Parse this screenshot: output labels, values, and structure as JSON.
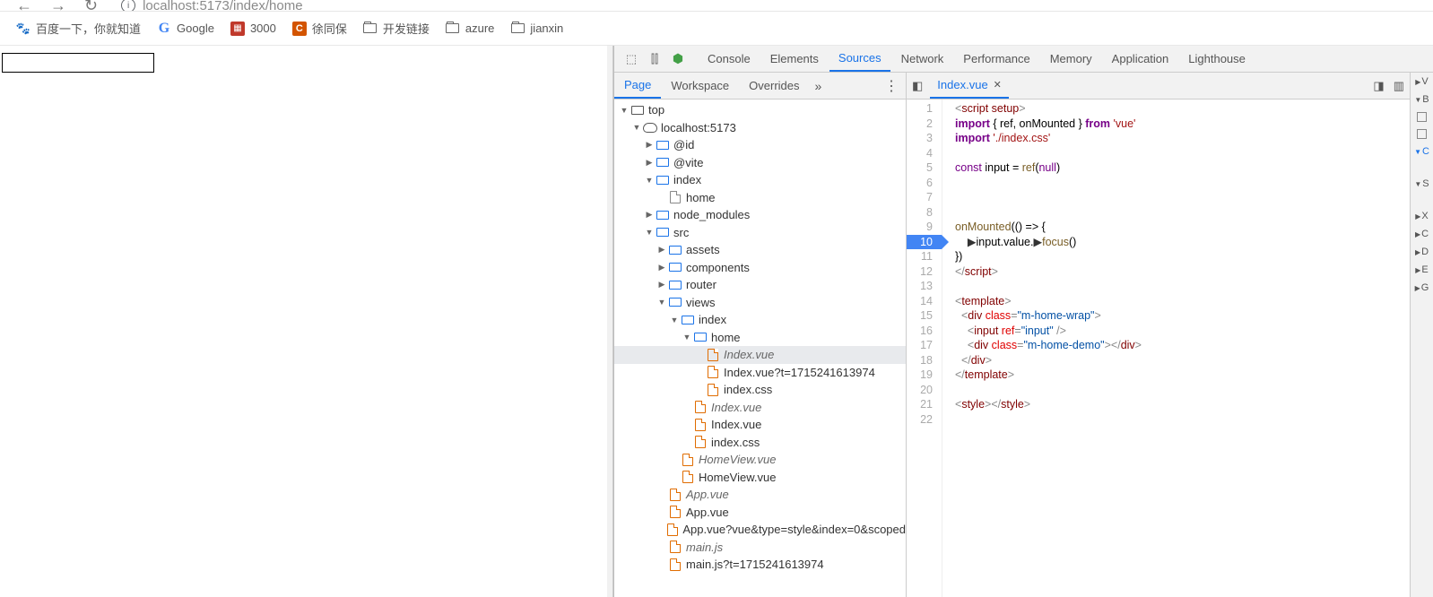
{
  "url": "localhost:5173/index/home",
  "bookmarks": [
    {
      "icon": "paw",
      "label": "百度一下，你就知道"
    },
    {
      "icon": "g",
      "label": "Google"
    },
    {
      "icon": "3000",
      "label": "3000"
    },
    {
      "icon": "c",
      "label": "徐同保"
    },
    {
      "icon": "folder",
      "label": "开发链接"
    },
    {
      "icon": "folder",
      "label": "azure"
    },
    {
      "icon": "folder",
      "label": "jianxin"
    }
  ],
  "devtoolsTabs": [
    "Console",
    "Elements",
    "Sources",
    "Network",
    "Performance",
    "Memory",
    "Application",
    "Lighthouse"
  ],
  "activeDevtoolsTab": "Sources",
  "sourcesTabs": [
    "Page",
    "Workspace",
    "Overrides"
  ],
  "activeSourcesTab": "Page",
  "tree": [
    {
      "d": 0,
      "tw": "▼",
      "ico": "fold",
      "label": "top"
    },
    {
      "d": 1,
      "tw": "▼",
      "ico": "cloud",
      "label": "localhost:5173"
    },
    {
      "d": 2,
      "tw": "▶",
      "ico": "foldb",
      "label": "@id"
    },
    {
      "d": 2,
      "tw": "▶",
      "ico": "foldb",
      "label": "@vite"
    },
    {
      "d": 2,
      "tw": "▼",
      "ico": "foldb",
      "label": "index"
    },
    {
      "d": 3,
      "tw": "",
      "ico": "file",
      "label": "home"
    },
    {
      "d": 2,
      "tw": "▶",
      "ico": "foldb",
      "label": "node_modules"
    },
    {
      "d": 2,
      "tw": "▼",
      "ico": "foldb",
      "label": "src"
    },
    {
      "d": 3,
      "tw": "▶",
      "ico": "foldb",
      "label": "assets"
    },
    {
      "d": 3,
      "tw": "▶",
      "ico": "foldb",
      "label": "components"
    },
    {
      "d": 3,
      "tw": "▶",
      "ico": "foldb",
      "label": "router"
    },
    {
      "d": 3,
      "tw": "▼",
      "ico": "foldb",
      "label": "views"
    },
    {
      "d": 4,
      "tw": "▼",
      "ico": "foldb",
      "label": "index"
    },
    {
      "d": 5,
      "tw": "▼",
      "ico": "foldb",
      "label": "home"
    },
    {
      "d": 6,
      "tw": "",
      "ico": "fileo",
      "label": "Index.vue",
      "italic": true,
      "sel": true
    },
    {
      "d": 6,
      "tw": "",
      "ico": "fileo",
      "label": "Index.vue?t=1715241613974"
    },
    {
      "d": 6,
      "tw": "",
      "ico": "fileo",
      "label": "index.css"
    },
    {
      "d": 5,
      "tw": "",
      "ico": "fileo",
      "label": "Index.vue",
      "italic": true
    },
    {
      "d": 5,
      "tw": "",
      "ico": "fileo",
      "label": "Index.vue"
    },
    {
      "d": 5,
      "tw": "",
      "ico": "fileo",
      "label": "index.css"
    },
    {
      "d": 4,
      "tw": "",
      "ico": "fileo",
      "label": "HomeView.vue",
      "italic": true
    },
    {
      "d": 4,
      "tw": "",
      "ico": "fileo",
      "label": "HomeView.vue"
    },
    {
      "d": 3,
      "tw": "",
      "ico": "fileo",
      "label": "App.vue",
      "italic": true
    },
    {
      "d": 3,
      "tw": "",
      "ico": "fileo",
      "label": "App.vue"
    },
    {
      "d": 3,
      "tw": "",
      "ico": "fileo",
      "label": "App.vue?vue&type=style&index=0&scoped"
    },
    {
      "d": 3,
      "tw": "",
      "ico": "fileo",
      "label": "main.js",
      "italic": true
    },
    {
      "d": 3,
      "tw": "",
      "ico": "fileo",
      "label": "main.js?t=1715241613974"
    }
  ],
  "openFile": "Index.vue",
  "highlightLine": 10,
  "code": [
    {
      "n": 1,
      "spans": [
        [
          "<",
          "gr"
        ],
        [
          "script setup",
          "tag"
        ],
        [
          ">",
          "gr"
        ]
      ]
    },
    {
      "n": 2,
      "spans": [
        [
          "import",
          "imp"
        ],
        [
          " { ref, onMounted } ",
          "id"
        ],
        [
          "from",
          "imp"
        ],
        [
          " ",
          "id"
        ],
        [
          "'vue'",
          "br"
        ]
      ]
    },
    {
      "n": 3,
      "spans": [
        [
          "import",
          "imp"
        ],
        [
          " ",
          "id"
        ],
        [
          "'./index.css'",
          "br"
        ]
      ]
    },
    {
      "n": 4,
      "spans": []
    },
    {
      "n": 5,
      "spans": [
        [
          "const",
          "kw"
        ],
        [
          " input = ",
          "id"
        ],
        [
          "ref",
          "fn"
        ],
        [
          "(",
          "id"
        ],
        [
          "null",
          "kw"
        ],
        [
          ")",
          "id"
        ]
      ]
    },
    {
      "n": 6,
      "spans": []
    },
    {
      "n": 7,
      "spans": []
    },
    {
      "n": 8,
      "spans": []
    },
    {
      "n": 9,
      "spans": [
        [
          "onMounted",
          "fn"
        ],
        [
          "(() => {",
          "id"
        ]
      ]
    },
    {
      "n": 10,
      "spans": [
        [
          "    ",
          "id"
        ],
        [
          "▶",
          "bp"
        ],
        [
          "input",
          "id"
        ],
        [
          ".value.",
          "id"
        ],
        [
          "▶",
          "bp"
        ],
        [
          "focus",
          "fn"
        ],
        [
          "()",
          "id"
        ]
      ]
    },
    {
      "n": 11,
      "spans": [
        [
          "})",
          "id"
        ]
      ]
    },
    {
      "n": 12,
      "spans": [
        [
          "</",
          "gr"
        ],
        [
          "script",
          "tag"
        ],
        [
          ">",
          "gr"
        ]
      ]
    },
    {
      "n": 13,
      "spans": []
    },
    {
      "n": 14,
      "spans": [
        [
          "<",
          "gr"
        ],
        [
          "template",
          "tag"
        ],
        [
          ">",
          "gr"
        ]
      ]
    },
    {
      "n": 15,
      "spans": [
        [
          "  <",
          "gr"
        ],
        [
          "div",
          "tag"
        ],
        [
          " class",
          "attr"
        ],
        [
          "=",
          "gr"
        ],
        [
          "\"m-home-wrap\"",
          "val"
        ],
        [
          ">",
          "gr"
        ]
      ]
    },
    {
      "n": 16,
      "spans": [
        [
          "    <",
          "gr"
        ],
        [
          "input",
          "tag"
        ],
        [
          " ref",
          "attr"
        ],
        [
          "=",
          "gr"
        ],
        [
          "\"input\"",
          "val"
        ],
        [
          " />",
          "gr"
        ]
      ]
    },
    {
      "n": 17,
      "spans": [
        [
          "    <",
          "gr"
        ],
        [
          "div",
          "tag"
        ],
        [
          " class",
          "attr"
        ],
        [
          "=",
          "gr"
        ],
        [
          "\"m-home-demo\"",
          "val"
        ],
        [
          "></",
          "gr"
        ],
        [
          "div",
          "tag"
        ],
        [
          ">",
          "gr"
        ]
      ]
    },
    {
      "n": 18,
      "spans": [
        [
          "  </",
          "gr"
        ],
        [
          "div",
          "tag"
        ],
        [
          ">",
          "gr"
        ]
      ]
    },
    {
      "n": 19,
      "spans": [
        [
          "</",
          "gr"
        ],
        [
          "template",
          "tag"
        ],
        [
          ">",
          "gr"
        ]
      ]
    },
    {
      "n": 20,
      "spans": []
    },
    {
      "n": 21,
      "spans": [
        [
          "<",
          "gr"
        ],
        [
          "style",
          "tag"
        ],
        [
          "></",
          "gr"
        ],
        [
          "style",
          "tag"
        ],
        [
          ">",
          "gr"
        ]
      ]
    },
    {
      "n": 22,
      "spans": []
    }
  ],
  "rightStrip": [
    "V",
    "B",
    "C",
    "S",
    "X",
    "C",
    "D",
    "E",
    "G"
  ]
}
